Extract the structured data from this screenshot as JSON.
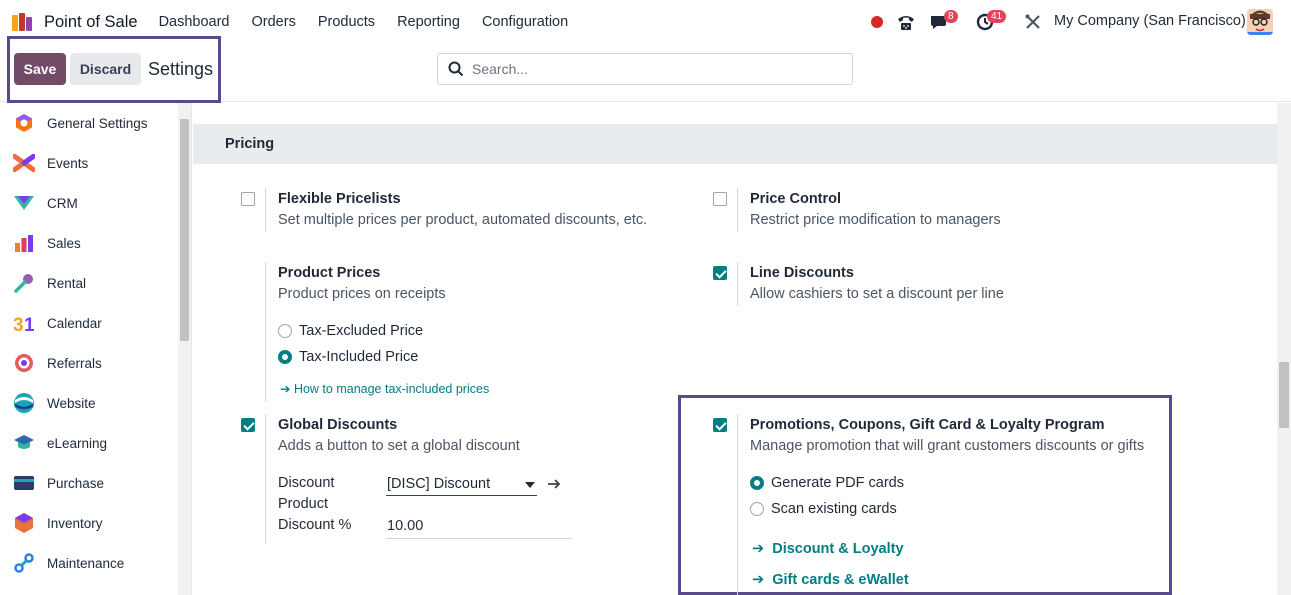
{
  "navbar": {
    "app_title": "Point of Sale",
    "menu": [
      "Dashboard",
      "Orders",
      "Products",
      "Reporting",
      "Configuration"
    ],
    "messages_badge": "8",
    "activities_badge": "41",
    "company": "My Company (San Francisco)"
  },
  "control_panel": {
    "save_label": "Save",
    "discard_label": "Discard",
    "title": "Settings",
    "search_placeholder": "Search..."
  },
  "sidebar": {
    "items": [
      {
        "label": "General Settings",
        "icon": "general-settings-icon",
        "color": "#f97316"
      },
      {
        "label": "Events",
        "icon": "events-icon",
        "color": "#f26b3a"
      },
      {
        "label": "CRM",
        "icon": "crm-icon",
        "color": "#2fb5a0"
      },
      {
        "label": "Sales",
        "icon": "sales-icon",
        "color": "#f07c3b"
      },
      {
        "label": "Rental",
        "icon": "rental-icon",
        "color": "#9b59b6"
      },
      {
        "label": "Calendar",
        "icon": "calendar-icon",
        "color": "#f2a51a"
      },
      {
        "label": "Referrals",
        "icon": "referrals-icon",
        "color": "#e25d5d"
      },
      {
        "label": "Website",
        "icon": "website-icon",
        "color": "#1aa6b7"
      },
      {
        "label": "eLearning",
        "icon": "elearning-icon",
        "color": "#2b6cb0"
      },
      {
        "label": "Purchase",
        "icon": "purchase-icon",
        "color": "#2d3b6b"
      },
      {
        "label": "Inventory",
        "icon": "inventory-icon",
        "color": "#e8733a"
      },
      {
        "label": "Maintenance",
        "icon": "maintenance-icon",
        "color": "#2b7de9"
      }
    ]
  },
  "pricing": {
    "section_title": "Pricing",
    "flexible_pricelists": {
      "title": "Flexible Pricelists",
      "desc": "Set multiple prices per product, automated discounts, etc.",
      "checked": false
    },
    "price_control": {
      "title": "Price Control",
      "desc": "Restrict price modification to managers",
      "checked": false
    },
    "product_prices": {
      "title": "Product Prices",
      "desc": "Product prices on receipts",
      "options": [
        "Tax-Excluded Price",
        "Tax-Included Price"
      ],
      "selected": "Tax-Included Price",
      "link": "How to manage tax-included prices"
    },
    "line_discounts": {
      "title": "Line Discounts",
      "desc": "Allow cashiers to set a discount per line",
      "checked": true
    },
    "global_discounts": {
      "title": "Global Discounts",
      "desc": "Adds a button to set a global discount",
      "checked": true,
      "discount_product_label_1": "Discount",
      "discount_product_label_2": "Product",
      "discount_product_value": "[DISC] Discount",
      "discount_pct_label": "Discount %",
      "discount_pct_value": "10.00"
    },
    "promotions": {
      "title": "Promotions, Coupons, Gift Card & Loyalty Program",
      "desc": "Manage promotion that will grant customers discounts or gifts",
      "checked": true,
      "options": [
        "Generate PDF cards",
        "Scan existing cards"
      ],
      "selected": "Generate PDF cards",
      "links": [
        "Discount & Loyalty",
        "Gift cards & eWallet"
      ]
    }
  },
  "colors": {
    "accent": "#017e84",
    "brand": "#714b67",
    "highlight": "#5b4a8b"
  }
}
